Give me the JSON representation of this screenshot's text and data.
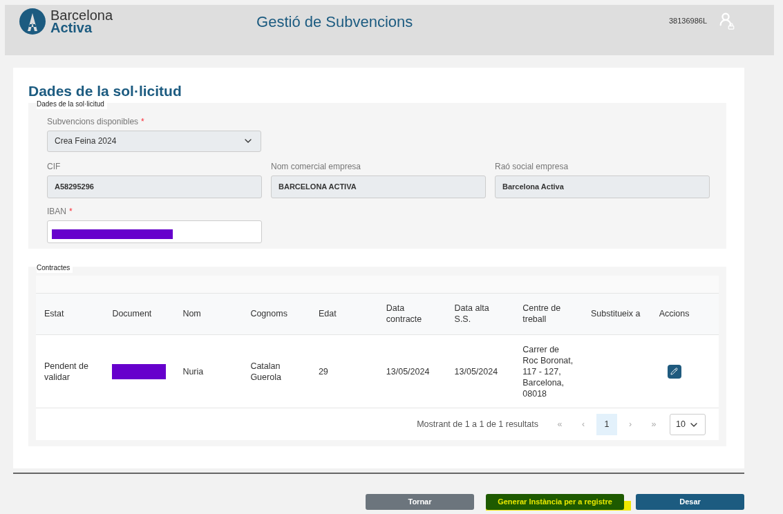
{
  "header": {
    "logo_top": "Barcelona",
    "logo_bottom": "Activa",
    "title": "Gestió de Subvencions",
    "user_id": "38136986L"
  },
  "page_title": "Dades de la sol·licitud",
  "form_section": {
    "legend": "Dades de la sol·licitud",
    "fields": [
      {
        "kind": "select",
        "label": "Subvencions disponibles",
        "required_mark": "*",
        "value": "Crea Feina 2024"
      },
      {
        "kind": "readonly",
        "label": "CIF",
        "value": "A58295296"
      },
      {
        "kind": "readonly",
        "label": "Nom comercial empresa",
        "value": "BARCELONA ACTIVA"
      },
      {
        "kind": "readonly",
        "label": "Raó social empresa",
        "value": "Barcelona Activa"
      },
      {
        "kind": "redacted",
        "label": "IBAN",
        "required_mark": "*"
      }
    ]
  },
  "contracts": {
    "legend": "Contractes",
    "columns": [
      "Estat",
      "Document",
      "Nom",
      "Cognoms",
      "Edat",
      "Data contracte",
      "Data alta S.S.",
      "Centre de treball",
      "Substitueix a",
      "Accions"
    ],
    "rows": [
      {
        "cells": [
          {
            "kind": "text",
            "text": "Pendent de validar"
          },
          {
            "kind": "redacted"
          },
          {
            "kind": "text",
            "text": "Nuria"
          },
          {
            "kind": "text",
            "text": "Catalan Guerola"
          },
          {
            "kind": "text",
            "text": "29"
          },
          {
            "kind": "text",
            "text": "13/05/2024"
          },
          {
            "kind": "text",
            "text": "13/05/2024"
          },
          {
            "kind": "text",
            "text": "Carrer de Roc Boronat, 117 - 127, Barcelona, 08018"
          },
          {
            "kind": "empty"
          },
          {
            "kind": "edit"
          }
        ]
      }
    ],
    "pagination": {
      "summary": "Mostrant de 1 a 1 de 1 resultats",
      "first": "«",
      "prev": "‹",
      "pages": [
        {
          "label": "1",
          "selected": true
        }
      ],
      "next": "›",
      "last": "»",
      "page_size": "10"
    }
  },
  "buttons": [
    {
      "kind": "secondary",
      "label": "Tornar",
      "highlighted": false
    },
    {
      "kind": "generate",
      "label": "Generar Instància per a registre",
      "highlighted": true
    },
    {
      "kind": "primary",
      "label": "Desar",
      "highlighted": false
    }
  ]
}
